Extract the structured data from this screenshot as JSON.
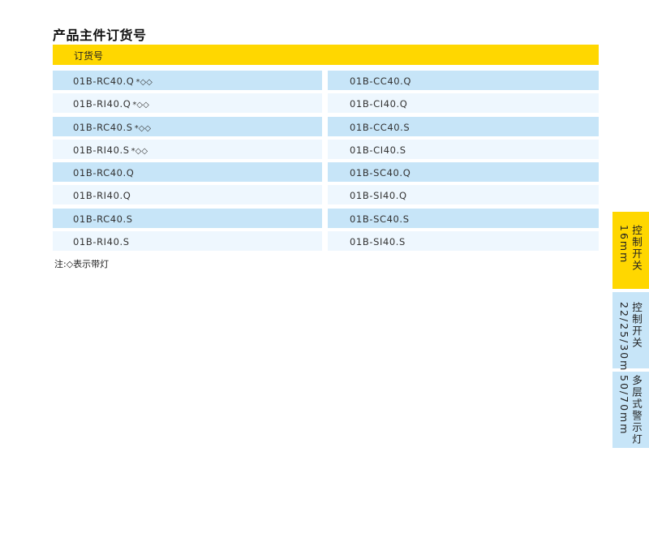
{
  "title": "产品主件订货号",
  "header_label": "订货号",
  "rows": [
    {
      "left": "01B-RC40.Q",
      "left_suffix": "*◇◇",
      "right": "01B-CC40.Q"
    },
    {
      "left": "01B-RI40.Q",
      "left_suffix": "*◇◇",
      "right": "01B-CI40.Q"
    },
    {
      "left": "01B-RC40.S",
      "left_suffix": "*◇◇",
      "right": "01B-CC40.S"
    },
    {
      "left": "01B-RI40.S",
      "left_suffix": "*◇◇",
      "right": "01B-CI40.S"
    },
    {
      "left": "01B-RC40.Q",
      "left_suffix": "",
      "right": "01B-SC40.Q"
    },
    {
      "left": "01B-RI40.Q",
      "left_suffix": "",
      "right": "01B-SI40.Q"
    },
    {
      "left": "01B-RC40.S",
      "left_suffix": "",
      "right": "01B-SC40.S"
    },
    {
      "left": "01B-RI40.S",
      "left_suffix": "",
      "right": "01B-SI40.S"
    }
  ],
  "note": "注:◇表示带灯",
  "side_tabs": [
    {
      "line1": "控制开关",
      "line2": "16mm"
    },
    {
      "line1": "控制开关",
      "line2": "22/25/30mm"
    },
    {
      "line1": "多层式警示灯",
      "line2": "50/70mm"
    }
  ],
  "colors": {
    "header_yellow": "#ffd700",
    "row_dark": "#c7e5f8",
    "row_light": "#eef7fe"
  }
}
